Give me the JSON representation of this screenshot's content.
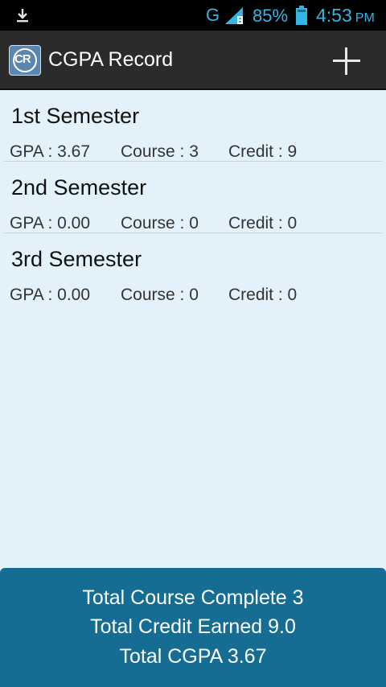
{
  "status_bar": {
    "download_icon": "download-arrow-icon",
    "network_type": "G",
    "signal_icon": "signal-bars-icon",
    "battery_percent": "85%",
    "battery_icon": "battery-icon",
    "time": "4:53",
    "am_pm": "PM",
    "color": "#33b5e5"
  },
  "action_bar": {
    "app_icon_text": "CR",
    "title": "CGPA Record",
    "add_icon": "plus-icon"
  },
  "semesters": [
    {
      "title": "1st Semester",
      "gpa": "GPA : 3.67",
      "course": "Course : 3",
      "credit": "Credit : 9"
    },
    {
      "title": "2nd Semester",
      "gpa": "GPA : 0.00",
      "course": "Course : 0",
      "credit": "Credit : 0"
    },
    {
      "title": "3rd Semester",
      "gpa": "GPA : 0.00",
      "course": "Course : 0",
      "credit": "Credit : 0"
    }
  ],
  "summary": {
    "total_course": "Total Course Complete 3",
    "total_credit": "Total Credit Earned 9.0",
    "total_cgpa": "Total CGPA 3.67"
  },
  "colors": {
    "background": "#e3f2fa",
    "action_bar": "#2b2b2b",
    "summary_panel": "#156d94"
  }
}
